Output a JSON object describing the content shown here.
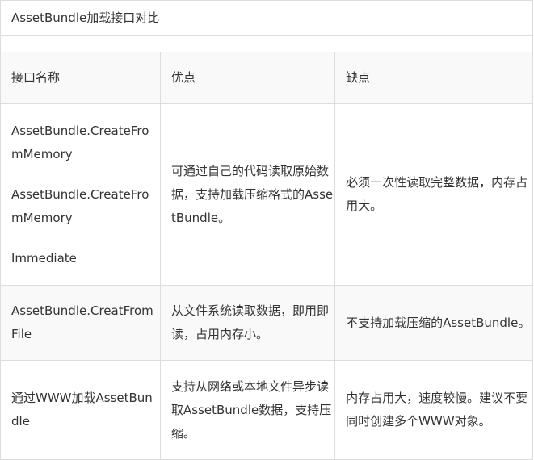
{
  "table": {
    "title": "AssetBundle加载接口对比",
    "headers": [
      "接口名称",
      "优点",
      "缺点"
    ],
    "rows": [
      {
        "interface": [
          "AssetBundle.CreateFromMemory",
          "AssetBundle.CreateFromMemory",
          "Immediate"
        ],
        "pros": "可通过自己的代码读取原始数据，支持加载压缩格式的AssetBundle。",
        "cons": "必须一次性读取完整数据，内存占用大。"
      },
      {
        "interface": [
          "AssetBundle.CreatFromFile"
        ],
        "pros": "从文件系统读取数据，即用即读，占用内存小。",
        "cons": "不支持加载压缩的AssetBundle。"
      },
      {
        "interface": [
          "通过WWW加载AssetBundle"
        ],
        "pros": "支持从网络或本地文件异步读取AssetBundle数据，支持压缩。",
        "cons": "内存占用大，速度较慢。建议不要同时创建多个WWW对象。"
      }
    ]
  }
}
